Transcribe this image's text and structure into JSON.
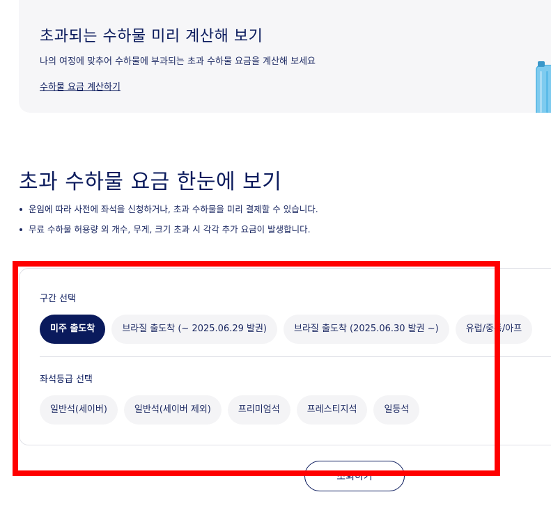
{
  "calculator": {
    "title": "초과되는 수하물 미리 계산해 보기",
    "description": "나의 여정에 맞추어 수하물에 부과되는 초과 수하물 요금을 계산해 보세요",
    "link_label": "수하물 요금 계산하기",
    "icon": "luggage-icon"
  },
  "section": {
    "title": "초과 수하물 요금 한눈에 보기",
    "notes": [
      "운임에 따라 사전에 좌석을 신청하거나, 초과 수하물을 미리 결제할 수 있습니다.",
      "무료 수하물 허용량 외 개수, 무게, 크기 초과 시 각각 추가 요금이 발생합니다."
    ]
  },
  "filters": {
    "route": {
      "label": "구간 선택",
      "options": [
        "미주 출도착",
        "브라질 출도착 (~ 2025.06.29 발권)",
        "브라질 출도착 (2025.06.30 발권 ~)",
        "유럽/중동/아프"
      ],
      "selected": "미주 출도착"
    },
    "cabin": {
      "label": "좌석등급 선택",
      "options": [
        "일반석(세이버)",
        "일반석(세이버 제외)",
        "프리미엄석",
        "프레스티지석",
        "일등석"
      ]
    }
  },
  "search_button_label": "조회하기",
  "colors": {
    "primary": "#0a1a5c",
    "chip_bg": "#f4f4f6",
    "card_bg": "#f6f6f8",
    "highlight": "#ff0000"
  }
}
